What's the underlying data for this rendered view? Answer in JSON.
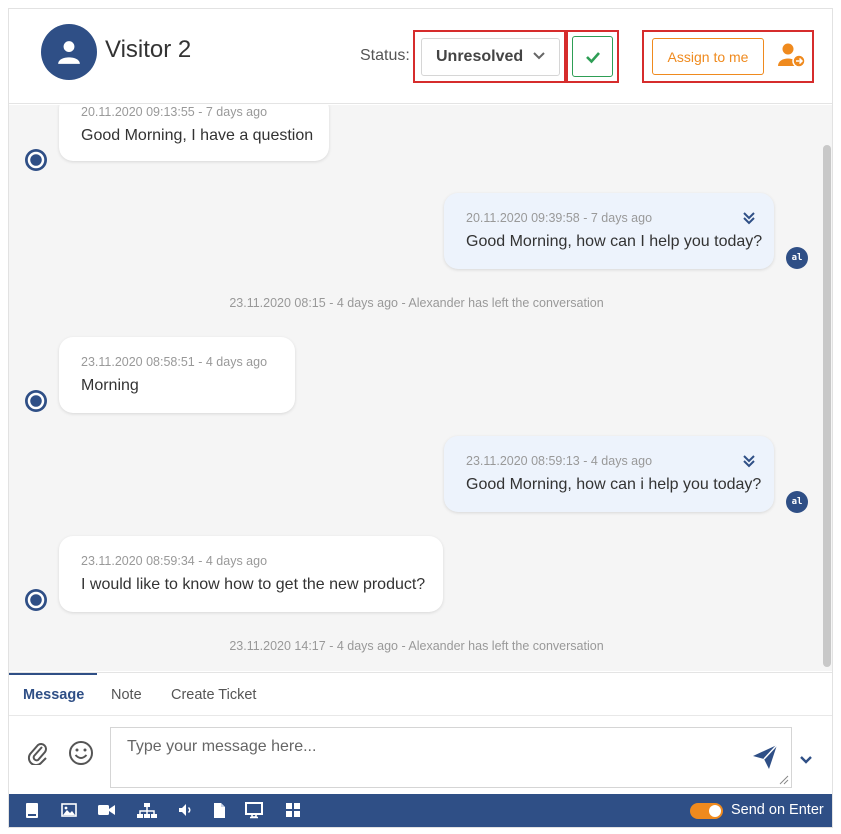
{
  "header": {
    "visitor_name": "Visitor 2",
    "status_label": "Status:",
    "status_value": "Unresolved",
    "assign_label": "Assign to me"
  },
  "messages": [
    {
      "timestamp": "20.11.2020 09:13:55 - 7 days ago",
      "text": "Good Morning, I have a question"
    },
    {
      "timestamp": "20.11.2020 09:39:58 - 7 days ago",
      "text": "Good Morning, how can I help you today?",
      "agent_initials": "al"
    },
    {
      "timestamp": "23.11.2020 08:58:51 - 4 days ago",
      "text": "Morning"
    },
    {
      "timestamp": "23.11.2020 08:59:13 - 4 days ago",
      "text": "Good Morning, how can i help you today?",
      "agent_initials": "al"
    },
    {
      "timestamp": "23.11.2020 08:59:34 - 4 days ago",
      "text": "I would like to know how to get the new product?"
    }
  ],
  "system_messages": [
    "23.11.2020 08:15 - 4 days ago - Alexander has left the conversation",
    "23.11.2020 14:17 - 4 days ago - Alexander has left the conversation"
  ],
  "tabs": [
    {
      "label": "Message",
      "active": true
    },
    {
      "label": "Note",
      "active": false
    },
    {
      "label": "Create Ticket",
      "active": false
    }
  ],
  "composer": {
    "placeholder": "Type your message here..."
  },
  "toolbar": {
    "icons": [
      "book-icon",
      "image-icon",
      "video-icon",
      "sitemap-icon",
      "audio-icon",
      "file-icon",
      "monitor-icon",
      "grid-icon"
    ],
    "send_on_enter_label": "Send on Enter",
    "send_on_enter": true
  },
  "colors": {
    "primary": "#2f4f86",
    "accent": "#ef8a1e",
    "success": "#2e9e55",
    "highlight": "#d62c2c"
  }
}
